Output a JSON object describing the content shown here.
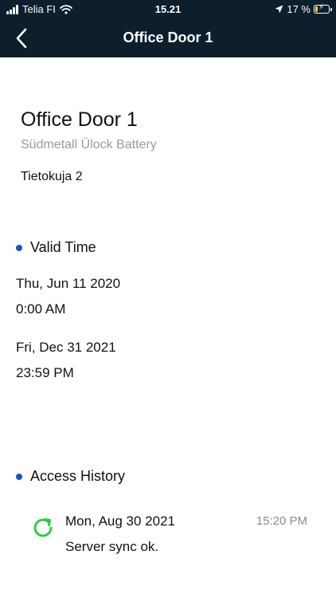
{
  "status_bar": {
    "carrier": "Telia FI",
    "time": "15.21",
    "battery_percent": "17 %",
    "battery_level": 0.17,
    "icons": [
      "signal-icon",
      "wifi-icon",
      "location-arrow-icon",
      "battery-charging-icon"
    ]
  },
  "nav": {
    "title": "Office Door 1",
    "back_icon": "chevron-left-icon"
  },
  "door": {
    "name": "Office Door 1",
    "model": "Südmetall Ülock Battery",
    "address": "Tietokuja 2"
  },
  "valid_time": {
    "header": "Valid Time",
    "start_date": "Thu, Jun 11 2020",
    "start_time": "0:00 AM",
    "end_date": "Fri, Dec 31 2021",
    "end_time": "23:59 PM"
  },
  "access_history": {
    "header": "Access History",
    "entries": [
      {
        "date": "Mon, Aug 30 2021",
        "status": "Server sync ok.",
        "time": "15:20 PM",
        "icon": "sync-icon"
      }
    ]
  },
  "colors": {
    "header_bg": "#0d1f2d",
    "bullet": "#1a56b8",
    "sync_icon": "#2ecc40",
    "muted_text": "#9a9a9a"
  }
}
